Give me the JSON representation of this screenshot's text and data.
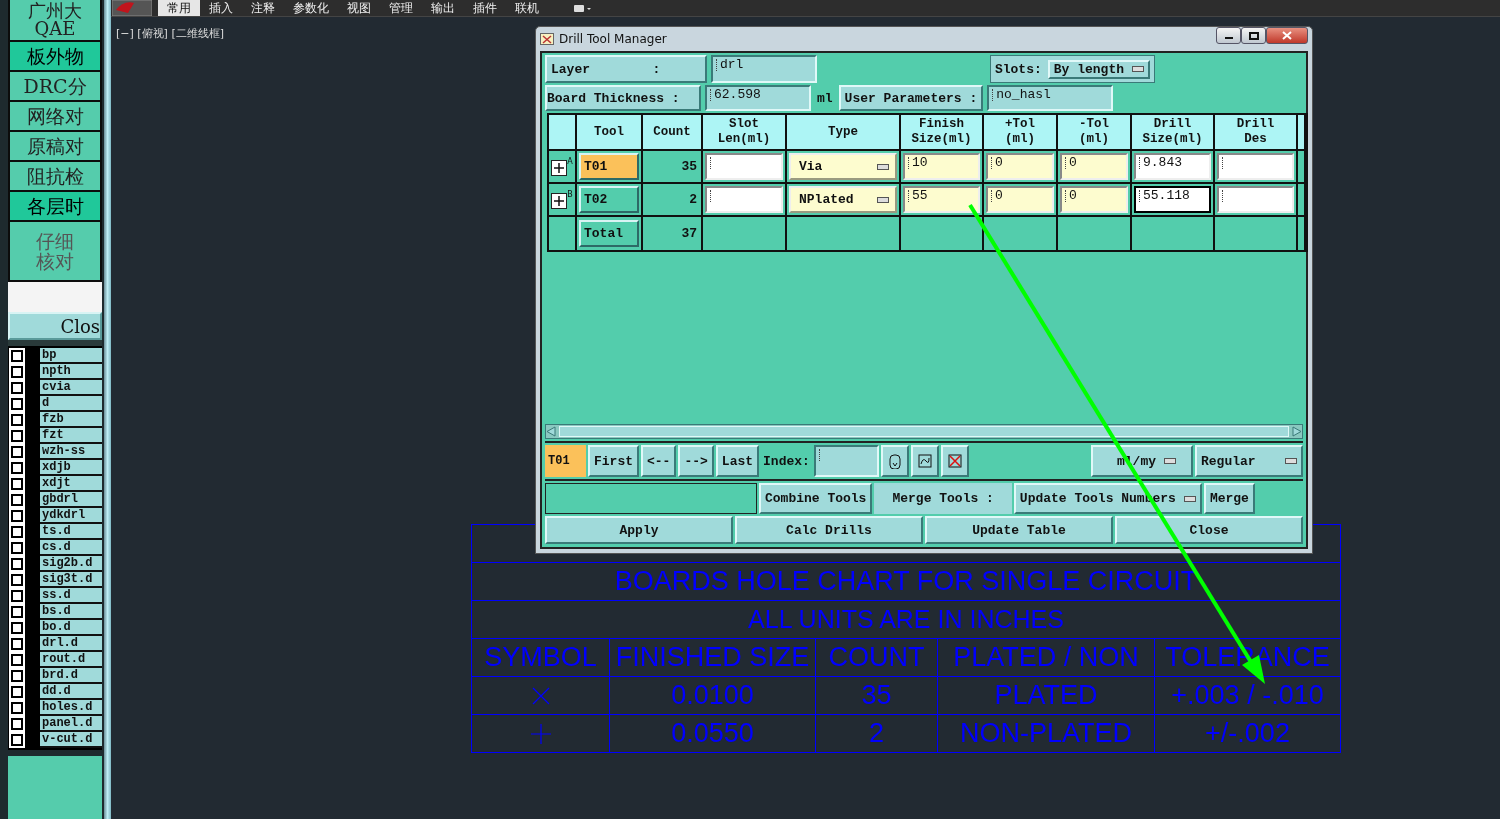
{
  "menu": {
    "tabs": [
      {
        "label": "常用",
        "selected": true
      },
      {
        "label": "插入",
        "selected": false
      },
      {
        "label": "注释",
        "selected": false
      },
      {
        "label": "参数化",
        "selected": false
      },
      {
        "label": "视图",
        "selected": false
      },
      {
        "label": "管理",
        "selected": false
      },
      {
        "label": "输出",
        "selected": false
      },
      {
        "label": "插件",
        "selected": false
      },
      {
        "label": "联机",
        "selected": false
      }
    ]
  },
  "viewport_label": "[−] [俯视] [二维线框]",
  "left_panel": {
    "header": [
      "广州大",
      "QAE"
    ],
    "buttons": [
      {
        "lines": [
          "板外物"
        ],
        "selected": true
      },
      {
        "lines": [
          "DRC分"
        ],
        "selected": false
      },
      {
        "lines": [
          "网络对"
        ],
        "selected": false
      },
      {
        "lines": [
          "原稿对"
        ],
        "selected": false
      },
      {
        "lines": [
          "阻抗检"
        ],
        "selected": false
      },
      {
        "lines": [
          "各层时"
        ],
        "selected": true
      },
      {
        "lines": [
          "仔细",
          "核对"
        ],
        "selected": false
      }
    ],
    "close_button": "Clos",
    "layers": [
      {
        "name": "bp",
        "checked": false
      },
      {
        "name": "npth",
        "checked": false
      },
      {
        "name": "cvia",
        "checked": false
      },
      {
        "name": "d",
        "checked": false
      },
      {
        "name": "fzb",
        "checked": false
      },
      {
        "name": "fzt",
        "checked": false
      },
      {
        "name": "wzh-ss",
        "checked": false
      },
      {
        "name": "xdjb",
        "checked": false
      },
      {
        "name": "xdjt",
        "checked": false
      },
      {
        "name": "gbdrl",
        "checked": false
      },
      {
        "name": "ydkdrl",
        "checked": false
      },
      {
        "name": "ts.d",
        "checked": false
      },
      {
        "name": "cs.d",
        "checked": false
      },
      {
        "name": "sig2b.d",
        "checked": false
      },
      {
        "name": "sig3t.d",
        "checked": false
      },
      {
        "name": "ss.d",
        "checked": false
      },
      {
        "name": "bs.d",
        "checked": false
      },
      {
        "name": "bo.d",
        "checked": false
      },
      {
        "name": "drl.d",
        "checked": false
      },
      {
        "name": "rout.d",
        "checked": false
      },
      {
        "name": "brd.d",
        "checked": false
      },
      {
        "name": "dd.d",
        "checked": false
      },
      {
        "name": "holes.d",
        "checked": false
      },
      {
        "name": "panel.d",
        "checked": false
      },
      {
        "name": "v-cut.d",
        "checked": false
      }
    ]
  },
  "dialog": {
    "title": "Drill Tool Manager",
    "layer": {
      "label": "Layer        :",
      "value": "drl"
    },
    "slots": {
      "label": "Slots:",
      "value": "By length"
    },
    "board_thickness": {
      "label": "Board Thickness :",
      "value": "62.598",
      "unit": "ml"
    },
    "user_parameters": {
      "label": "User Parameters :",
      "value": "no_hasl"
    },
    "table": {
      "columns": [
        "Tool",
        "Count",
        "Slot\nLen(ml)",
        "Type",
        "Finish\nSize(ml)",
        "+Tol\n(ml)",
        "-Tol\n(ml)",
        "Drill\nSize(ml)",
        "Drill\nDes"
      ],
      "rows": [
        {
          "marker": "A",
          "tool": "T01",
          "selected": true,
          "count": "35",
          "type": "Via",
          "finish_size": "10",
          "plus_tol": "0",
          "minus_tol": "0",
          "drill_size": "9.843",
          "focused": false
        },
        {
          "marker": "B",
          "tool": "T02",
          "selected": false,
          "count": "2",
          "type": "NPlated",
          "finish_size": "55",
          "plus_tol": "0",
          "minus_tol": "0",
          "drill_size": "55.118",
          "focused": true
        }
      ],
      "total": {
        "label": "Total",
        "count": "37"
      }
    },
    "nav": {
      "current": "T01",
      "buttons": [
        "First",
        "<--",
        "-->",
        "Last"
      ],
      "index_label": "Index:",
      "units": "ml/my",
      "mode": "Regular"
    },
    "merge": {
      "combine": "Combine Tools",
      "label": "Merge Tools :",
      "option": "Update Tools Numbers",
      "button": "Merge"
    },
    "actions": [
      "Apply",
      "Calc Drills",
      "Update Table",
      "Close"
    ]
  },
  "hole_chart": {
    "title": "BOARDS HOLE CHART FOR SINGLE CIRCUIT",
    "subtitle": "ALL UNITS ARE IN INCHES",
    "columns": [
      "SYMBOL",
      "FINISHED SIZE",
      "COUNT",
      "PLATED / NON",
      "TOLERANCE"
    ],
    "rows": [
      {
        "kind": "cross",
        "finished_size": "0.0100",
        "count": "35",
        "plating": "PLATED",
        "tolerance": "+.003 / -.010"
      },
      {
        "kind": "plus",
        "finished_size": "0.0550",
        "count": "2",
        "plating": "NON-PLATED",
        "tolerance": "+/-.002"
      }
    ]
  }
}
